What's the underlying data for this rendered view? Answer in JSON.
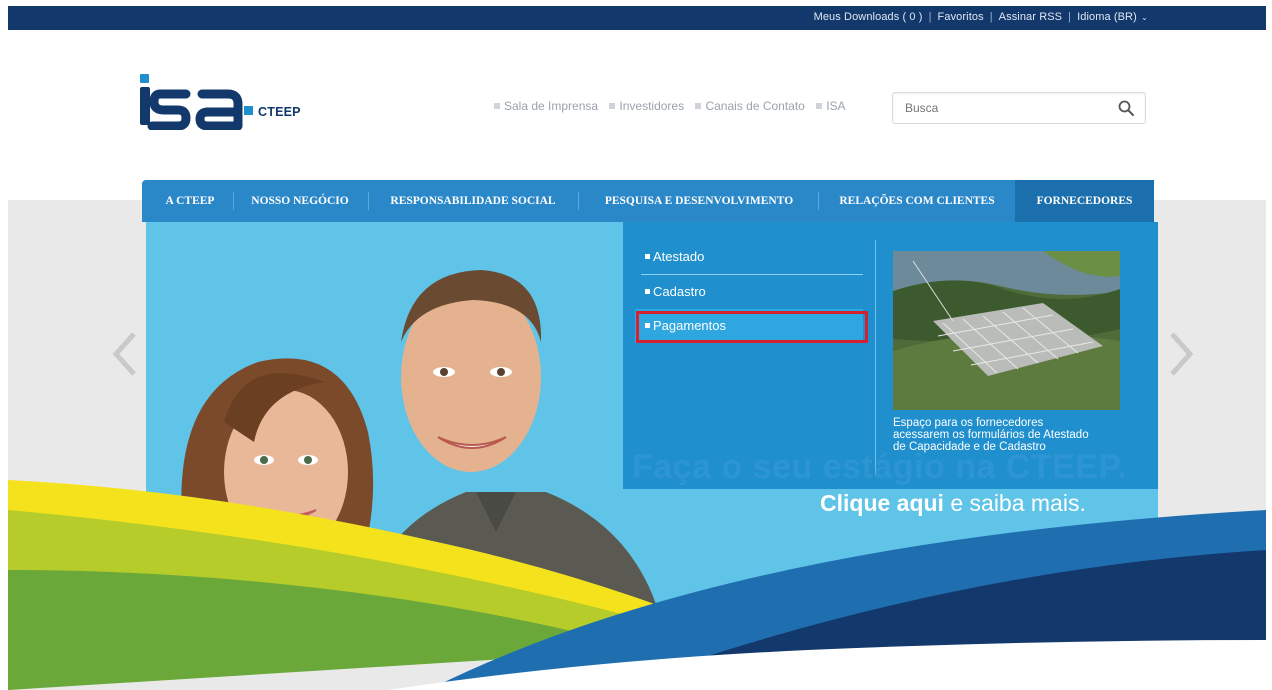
{
  "top_bar": {
    "links": [
      "Meus Downloads ( 0 )",
      "Favoritos",
      "Assinar RSS",
      "Idioma (BR)"
    ]
  },
  "header": {
    "logo_text": "isa",
    "logo_sub": "CTEEP",
    "links": [
      "Sala de Imprensa",
      "Investidores",
      "Canais de Contato",
      "ISA"
    ],
    "search_placeholder": "Busca"
  },
  "nav": {
    "items": [
      "A CTEEP",
      "NOSSO NEGÓCIO",
      "RESPONSABILIDADE SOCIAL",
      "PESQUISA E DESENVOLVIMENTO",
      "RELAÇÕES COM CLIENTES",
      "FORNECEDORES"
    ],
    "active": "FORNECEDORES"
  },
  "dropdown": {
    "items": [
      "Atestado",
      "Cadastro",
      "Pagamentos"
    ],
    "highlighted": "Pagamentos",
    "description": "Espaço para os fornecedores acessarem os formulários de Atestado de Capacidade e de Cadastro"
  },
  "hero": {
    "ghost_text": "Faça o seu estágio na CTEEP.",
    "cta_bold": "Clique aqui",
    "cta_rest": " e saiba mais."
  },
  "colors": {
    "top_bar": "#13386b",
    "nav": "#2a87c8",
    "nav_active": "#1c6fad",
    "dropdown": "#1f8fcd",
    "highlight": "#d42030"
  }
}
